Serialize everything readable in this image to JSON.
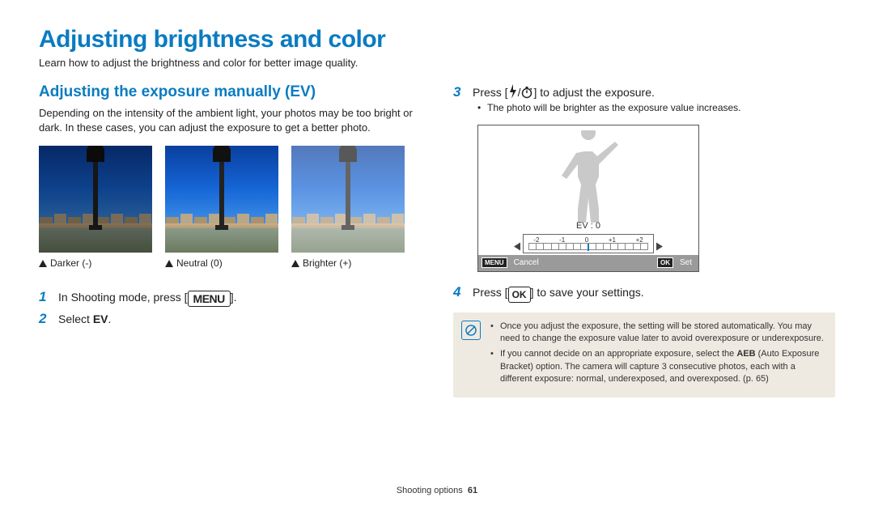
{
  "title": "Adjusting brightness and color",
  "intro": "Learn how to adjust the brightness and color for better image quality.",
  "left": {
    "section_title": "Adjusting the exposure manually (EV)",
    "section_body": "Depending on the intensity of the ambient light, your photos may be too bright or dark. In these cases, you can adjust the exposure to get a better photo.",
    "sample_captions": {
      "darker": "Darker (-)",
      "neutral": "Neutral (0)",
      "brighter": "Brighter (+)"
    },
    "step1_pre": "In Shooting mode, press [",
    "step1_btn": "MENU",
    "step1_post": "].",
    "step2_pre": "Select ",
    "step2_strong": "EV",
    "step2_post": "."
  },
  "right": {
    "step3_pre": "Press [",
    "step3_post": "] to adjust the exposure.",
    "step3_bullet": "The photo will be brighter as the exposure value increases.",
    "cam": {
      "ev_label": "EV : 0",
      "ticks": [
        "-2",
        "-1",
        "0",
        "+1",
        "+2"
      ],
      "menu_label": "MENU",
      "cancel": "Cancel",
      "ok_label": "OK",
      "set": "Set"
    },
    "step4_pre": "Press [",
    "step4_btn": "OK",
    "step4_post": "] to save your settings.",
    "note1": "Once you adjust the exposure, the setting will be stored automatically. You may need to change the exposure value later to avoid overexposure or underexposure.",
    "note2_pre": "If you cannot decide on an appropriate exposure, select the ",
    "note2_strong": "AEB",
    "note2_mid": " (Auto Exposure Bracket) option. The camera will capture 3 consecutive photos, each with a different exposure: normal, underexposed, and overexposed. (p. 65)"
  },
  "footer": {
    "section": "Shooting options",
    "page": "61"
  }
}
